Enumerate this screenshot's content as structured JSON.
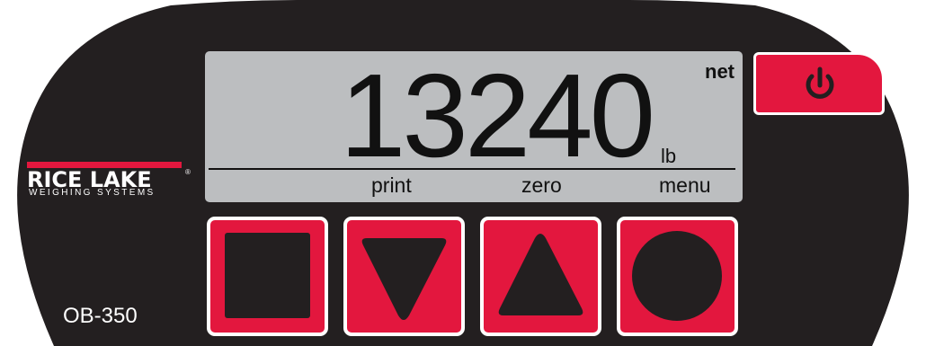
{
  "brand": {
    "name": "RICE LAKE",
    "registered_mark": "®",
    "tagline": "WEIGHING SYSTEMS"
  },
  "model": "OB-350",
  "display": {
    "value": "13240",
    "unit": "lb",
    "mode": "net",
    "softkey_labels": {
      "key2": "print",
      "key3": "zero",
      "key4": "menu"
    }
  },
  "colors": {
    "panel": "#231f20",
    "accent_red": "#e3173e",
    "lcd": "#bcbec0",
    "border": "#ffffff"
  },
  "icons": {
    "power": "power-icon",
    "key1": "square-icon",
    "key2": "triangle-down-icon",
    "key3": "triangle-up-icon",
    "key4": "circle-icon"
  }
}
